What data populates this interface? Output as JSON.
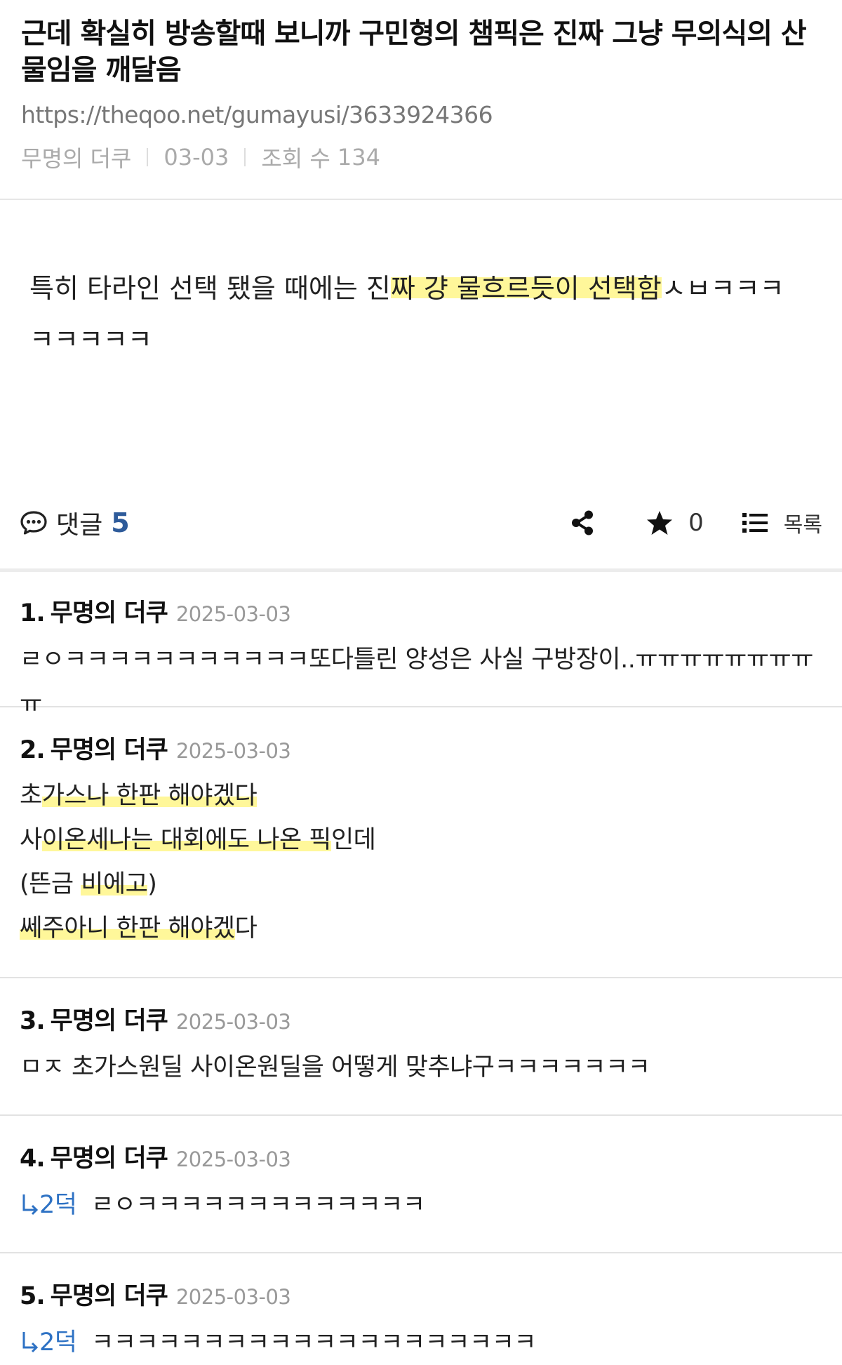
{
  "post": {
    "title": "근데 확실히 방송할때 보니까 구민형의 챔픽은 진짜 그냥 무의식의 산물임을 깨달음",
    "url": "https://theqoo.net/gumayusi/3633924366",
    "author": "무명의 더쿠",
    "date": "03-03",
    "views_label": "조회 수",
    "views": "134",
    "body_line1_a": "특히 타라인 선택 됐을 때에는 진",
    "body_line1_b": "짜 걍 물흐르듯이 선택함",
    "body_line1_c": "ㅅㅂㅋㅋㅋ",
    "body_line2": "ㅋㅋㅋㅋㅋ"
  },
  "actions": {
    "comments_label": "댓글",
    "comments_count": "5",
    "star_count": "0",
    "list_label": "목록"
  },
  "comments": [
    {
      "num": "1.",
      "author": "무명의 더쿠",
      "date": "2025-03-03",
      "text": "ㄹㅇㅋㅋㅋㅋㅋㅋㅋㅋㅋㅋㅋ또다틀린 양성은 사실 구방장이..ㅠㅠㅠㅠㅠㅠㅠㅠㅠ"
    },
    {
      "num": "2.",
      "author": "무명의 더쿠",
      "date": "2025-03-03",
      "lines": [
        {
          "a": "초",
          "b": "가스나 한판 해야겠다",
          "c": ""
        },
        {
          "a": "사",
          "b": "이온세나는 대회에도 나온 픽",
          "c": "인데"
        },
        {
          "a": "(뜬금 ",
          "b": "비에고",
          "c": ")"
        },
        {
          "a": "",
          "b": "쎄주아니 한판 해야겠",
          "c": "다"
        }
      ]
    },
    {
      "num": "3.",
      "author": "무명의 더쿠",
      "date": "2025-03-03",
      "text": "ㅁㅈ 초가스원딜 사이온원딜을 어떻게 맞추냐구ㅋㅋㅋㅋㅋㅋㅋ"
    },
    {
      "num": "4.",
      "author": "무명의 더쿠",
      "date": "2025-03-03",
      "reply_to": "2덕",
      "text": "ㄹㅇㅋㅋㅋㅋㅋㅋㅋㅋㅋㅋㅋㅋㅋ"
    },
    {
      "num": "5.",
      "author": "무명의 더쿠",
      "date": "2025-03-03",
      "reply_to": "2덕",
      "text": "ㅋㅋㅋㅋㅋㅋㅋㅋㅋㅋㅋㅋㅋㅋㅋㅋㅋㅋㅋㅋ"
    }
  ]
}
